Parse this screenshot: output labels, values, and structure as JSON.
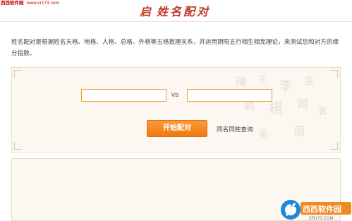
{
  "header": {
    "site_name": "西西软件园",
    "site_url": "www.cr173.com",
    "title_seal": "启",
    "title": "姓名配对"
  },
  "description": "姓名配对是根据姓名天格、地格、人格、总格、外格等五格数理关系，并运用阴阳五行相生相克理论，来测试您和对方的缘分指数。",
  "form": {
    "name1_value": "",
    "name2_value": "",
    "vs_label": "vs",
    "start_button": "开始配对",
    "same_name_link": "同名同姓查询"
  },
  "decor": {
    "calligraphy_glyphs": [
      "陳",
      "王",
      "李",
      "張",
      "劉",
      "楊",
      "趙",
      "黃",
      "吳",
      "周"
    ]
  },
  "watermark": {
    "brand": "西西软件园",
    "url": "CR173.COM"
  },
  "colors": {
    "accent": "#f08a22",
    "title_red": "#c0392b",
    "panel_bg": "#fcf8f1"
  }
}
